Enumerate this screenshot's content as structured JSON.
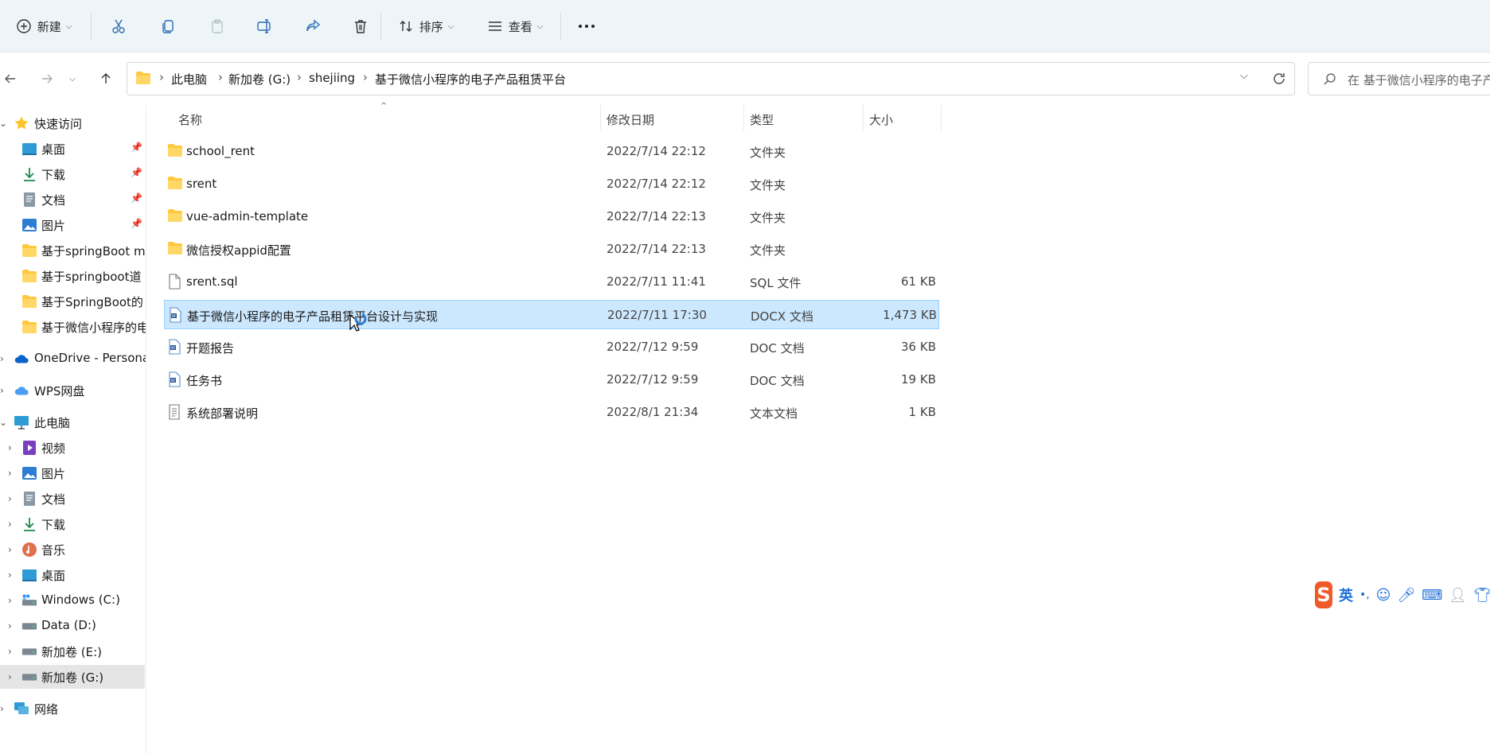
{
  "toolbar": {
    "new_label": "新建",
    "sort_label": "排序",
    "view_label": "查看"
  },
  "breadcrumb": [
    "此电脑",
    "新加卷 (G:)",
    "shejiing",
    "基于微信小程序的电子产品租赁平台"
  ],
  "search": {
    "placeholder": "在 基于微信小程序的电子产"
  },
  "sidebar": {
    "quick_access": "快速访问",
    "quick_items": [
      "桌面",
      "下载",
      "文档",
      "图片",
      "基于springBoot m",
      "基于springboot道",
      "基于SpringBoot的",
      "基于微信小程序的电"
    ],
    "onedrive": "OneDrive - Persona",
    "wps": "WPS网盘",
    "this_pc": "此电脑",
    "pc_items": [
      "视频",
      "图片",
      "文档",
      "下载",
      "音乐",
      "桌面",
      "Windows (C:)",
      "Data (D:)",
      "新加卷 (E:)",
      "新加卷 (G:)"
    ],
    "network": "网络"
  },
  "columns": {
    "name": "名称",
    "modified": "修改日期",
    "type": "类型",
    "size": "大小"
  },
  "files": [
    {
      "name": "school_rent",
      "modified": "2022/7/14 22:12",
      "type": "文件夹",
      "size": "",
      "icon": "folder-icon"
    },
    {
      "name": "srent",
      "modified": "2022/7/14 22:12",
      "type": "文件夹",
      "size": "",
      "icon": "folder-icon"
    },
    {
      "name": "vue-admin-template",
      "modified": "2022/7/14 22:13",
      "type": "文件夹",
      "size": "",
      "icon": "folder-icon"
    },
    {
      "name": "微信授权appid配置",
      "modified": "2022/7/14 22:13",
      "type": "文件夹",
      "size": "",
      "icon": "folder-icon"
    },
    {
      "name": "srent.sql",
      "modified": "2022/7/11 11:41",
      "type": "SQL 文件",
      "size": "61 KB",
      "icon": "file-icon"
    },
    {
      "name": "基于微信小程序的电子产品租赁平台设计与实现",
      "modified": "2022/7/11 17:30",
      "type": "DOCX 文档",
      "size": "1,473 KB",
      "icon": "word-doc-icon"
    },
    {
      "name": "开题报告",
      "modified": "2022/7/12 9:59",
      "type": "DOC 文档",
      "size": "36 KB",
      "icon": "word-doc-icon"
    },
    {
      "name": "任务书",
      "modified": "2022/7/12 9:59",
      "type": "DOC 文档",
      "size": "19 KB",
      "icon": "word-doc-icon"
    },
    {
      "name": "系统部署说明",
      "modified": "2022/8/1 21:34",
      "type": "文本文档",
      "size": "1 KB",
      "icon": "text-file-icon"
    }
  ],
  "ime": {
    "mode": "英",
    "punct": "•,"
  },
  "colors": {
    "accent": "#0067c0",
    "selection": "#cce8ff",
    "folder": "#ffc83d"
  }
}
